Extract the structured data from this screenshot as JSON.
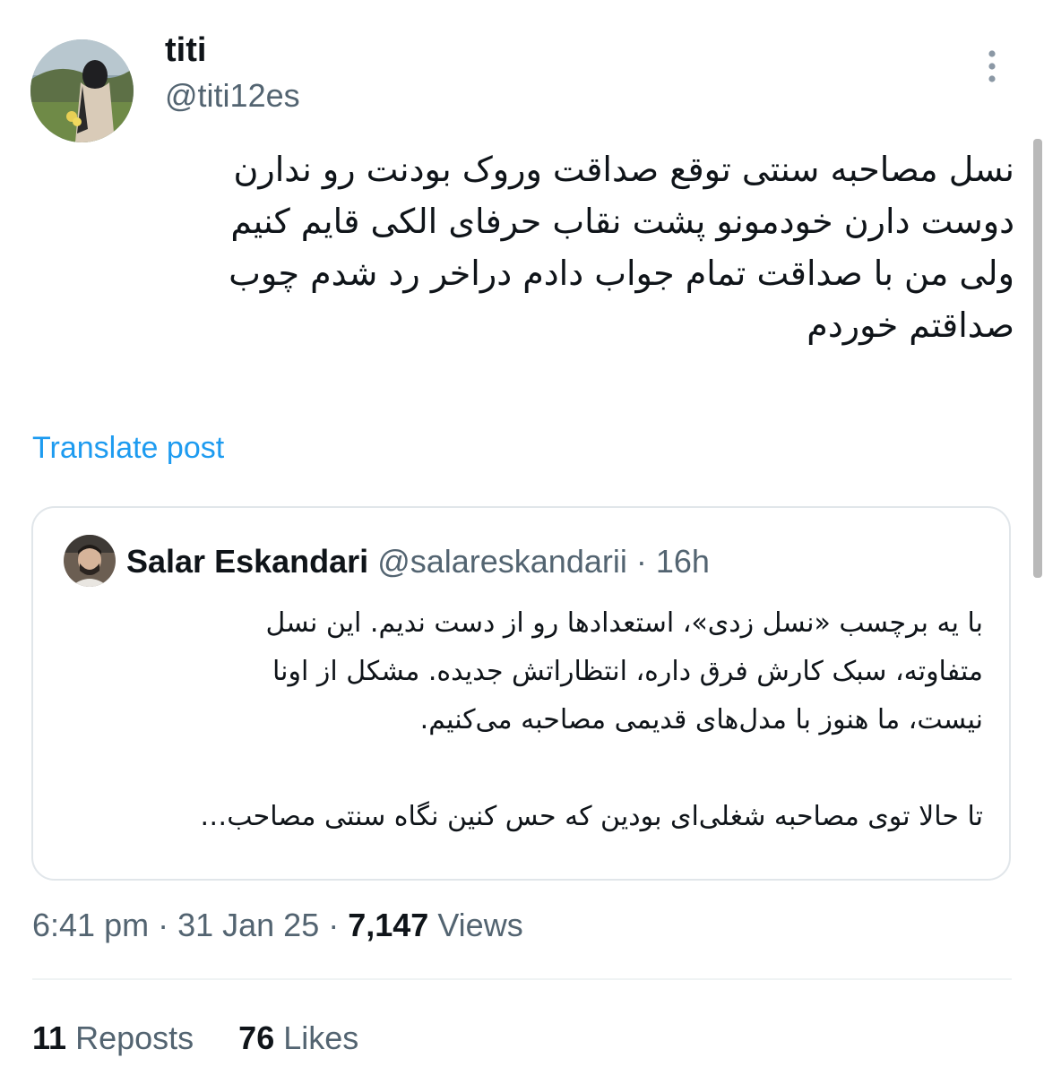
{
  "author": {
    "name": "titi",
    "handle": "@titi12es"
  },
  "tweet": {
    "lines": [
      "نسل مصاحبه سنتی توقع صداقت وروک بودنت رو ندارن",
      " دوست دارن خودمونو پشت نقاب حرفای الکی قایم کنیم",
      "ولی من با صداقت تمام جواب دادم دراخر رد شدم چوب",
      "صداقتم خوردم"
    ],
    "translate_label": "Translate post"
  },
  "quote": {
    "name": "Salar Eskandari",
    "handle": "@salareskandarii",
    "separator": " · ",
    "time": "16h",
    "lines": [
      "با یه برچسب «نسل زدی»، استعدادها رو از دست ندیم. این نسل",
      "متفاوته، سبک کارش فرق داره، انتظاراتش جدیده. مشکل از اونا",
      "نیست، ما هنوز با مدل‌های قدیمی مصاحبه می‌کنیم."
    ],
    "truncated_line": "تا حالا توی مصاحبه شغلی‌ای بودین که حس کنین نگاه سنتی مصاحب…"
  },
  "meta": {
    "time": "6:41 pm",
    "date": "31 Jan 25",
    "dot": " · ",
    "views_count": "7,147",
    "views_label": " Views"
  },
  "stats": {
    "reposts_count": "11",
    "reposts_label": " Reposts",
    "likes_count": "76",
    "likes_label": " Likes"
  },
  "colors": {
    "link": "#1d9bf0",
    "secondary_text": "#536471",
    "primary_text": "#0f1419",
    "border": "#e1e6ea"
  },
  "icons": {
    "more": "more-vertical-icon"
  }
}
